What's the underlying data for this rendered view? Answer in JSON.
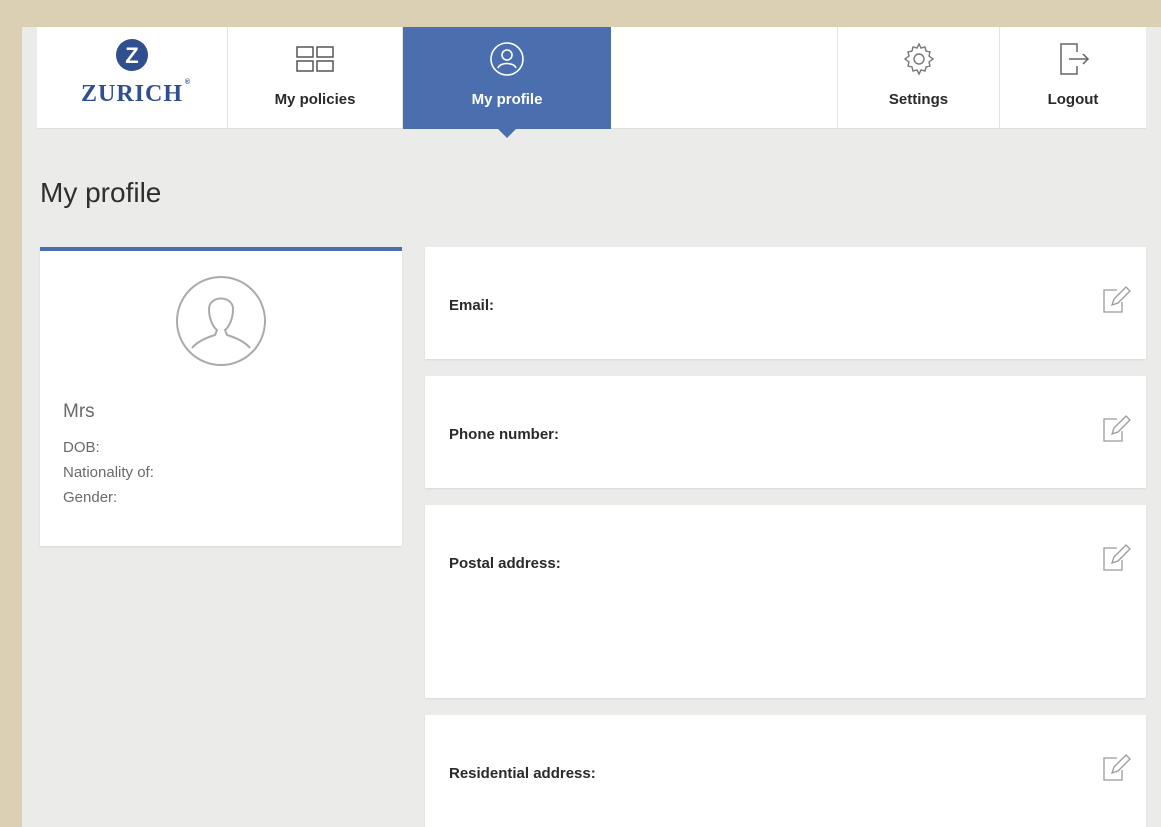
{
  "nav": {
    "logo_text": "ZURICH",
    "logo_mark": "Z",
    "items": [
      {
        "label": "My policies",
        "icon": "grid-icon"
      },
      {
        "label": "My profile",
        "icon": "user-circle-icon"
      },
      {
        "label": "Settings",
        "icon": "gear-icon"
      },
      {
        "label": "Logout",
        "icon": "logout-icon"
      }
    ]
  },
  "page": {
    "title": "My profile"
  },
  "profile": {
    "salutation": "Mrs",
    "dob_label": "DOB:",
    "nationality_label": "Nationality of:",
    "gender_label": "Gender:"
  },
  "fields": {
    "email": {
      "label": "Email:"
    },
    "phone": {
      "label": "Phone number:"
    },
    "postal": {
      "label": "Postal address:"
    },
    "residential": {
      "label": "Residential address:"
    }
  },
  "colors": {
    "accent": "#4b6fae",
    "frame": "#dcd0b4",
    "background": "#ebebea"
  }
}
